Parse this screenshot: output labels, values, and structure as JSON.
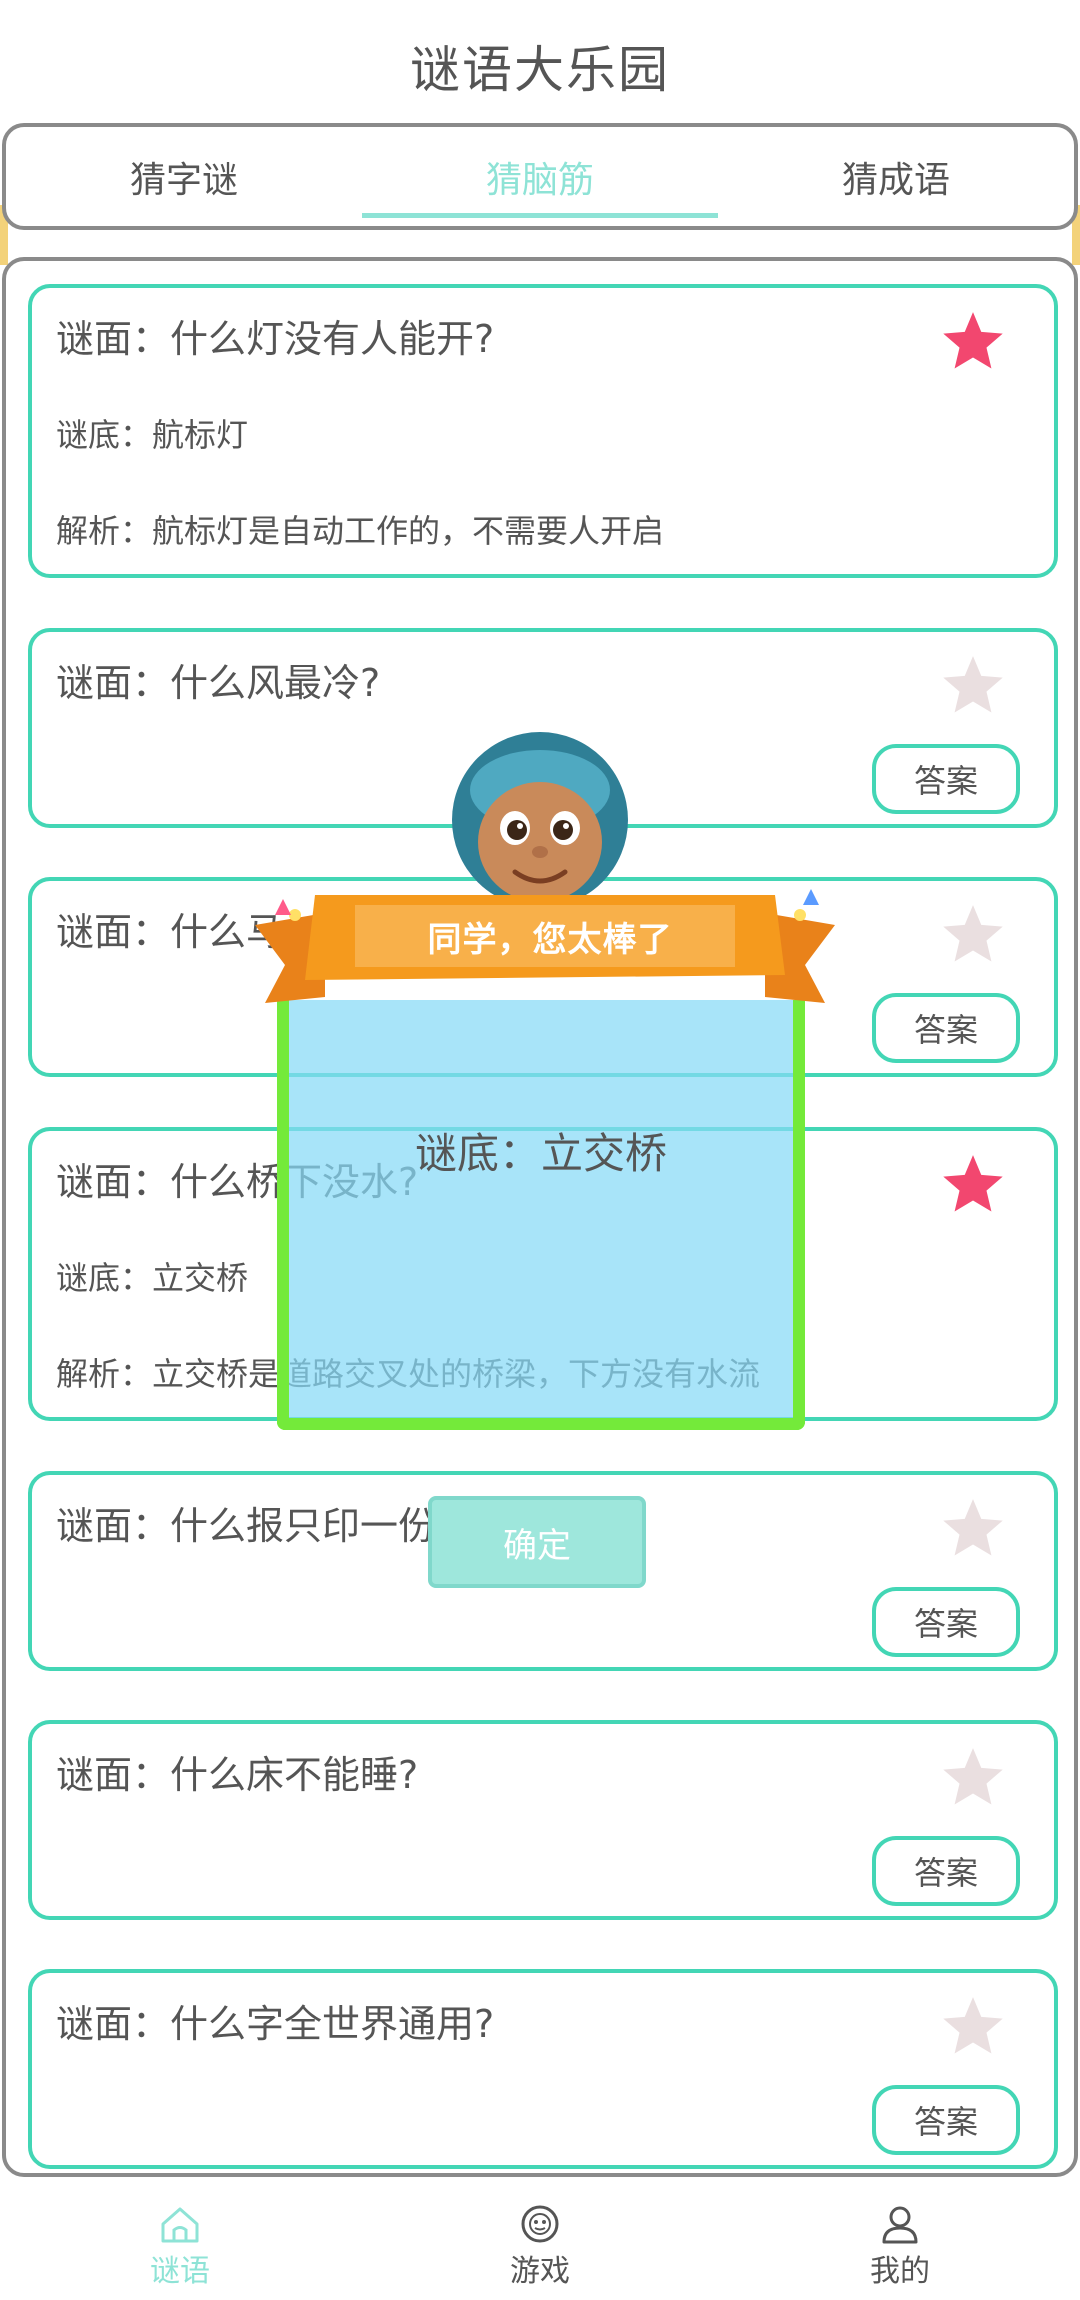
{
  "app": {
    "title": "谜语大乐园"
  },
  "tabs": [
    {
      "label": "猜字谜",
      "active": false
    },
    {
      "label": "猜脑筋",
      "active": true
    },
    {
      "label": "猜成语",
      "active": false
    }
  ],
  "colors": {
    "accent": "#43d6b5",
    "tab_active": "#8ee3d6",
    "star_on": "#f2476f",
    "star_off": "#eadfe0",
    "modal_border": "#74ea3a",
    "ribbon": "#f59a1d"
  },
  "cards": [
    {
      "question": "谜面：什么灯没有人能开?",
      "answer": "谜底：航标灯",
      "explain": "解析：航标灯是自动工作的，不需要人开启",
      "favorited": true
    },
    {
      "question": "谜面：什么风最冷?",
      "button": "答案",
      "favorited": false
    },
    {
      "question": "谜面：什么马",
      "button": "答案",
      "favorited": false
    },
    {
      "question": "谜面：什么桥下没水?",
      "answer": "谜底：立交桥",
      "explain": "解析：立交桥是道路交叉处的桥梁，下方没有水流",
      "favorited": true
    },
    {
      "question": "谜面：什么报只印一份?",
      "button": "答案",
      "favorited": false
    },
    {
      "question": "谜面：什么床不能睡?",
      "button": "答案",
      "favorited": false
    },
    {
      "question": "谜面：什么字全世界通用?",
      "button": "答案",
      "favorited": false
    }
  ],
  "modal": {
    "banner": "同学，您太棒了",
    "answer": "谜底：立交桥",
    "confirm": "确定"
  },
  "nav": [
    {
      "label": "谜语",
      "icon": "house-icon",
      "active": true
    },
    {
      "label": "游戏",
      "icon": "game-icon",
      "active": false
    },
    {
      "label": "我的",
      "icon": "person-icon",
      "active": false
    }
  ]
}
